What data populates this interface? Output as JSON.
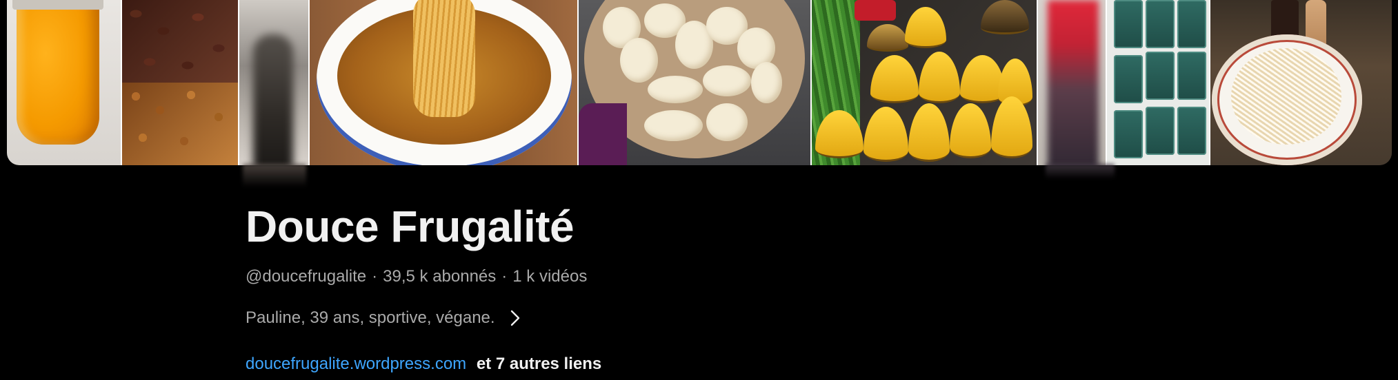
{
  "channel": {
    "name": "Douce Frugalité",
    "handle": "@doucefrugalite",
    "separator": "·",
    "subscribers": "39,5 k abonnés",
    "videos": "1 k vidéos",
    "description": "Pauline, 39 ans, sportive, végane.",
    "link": "doucefrugalite.wordpress.com",
    "more_links": "et 7 autres liens"
  },
  "banner": {
    "tiles": [
      "orange-juice",
      "dates",
      "blurred-person",
      "noodle-soup",
      "pears-and-bananas",
      "bananas",
      "blurred-person",
      "rice-bags",
      "rice-noodle-plate"
    ]
  },
  "icons": {
    "description_expand": "chevron-right-icon"
  },
  "colors": {
    "background": "#000000",
    "title": "#f1f1f1",
    "secondary_text": "#aaaaaa",
    "link": "#3ea6ff"
  }
}
